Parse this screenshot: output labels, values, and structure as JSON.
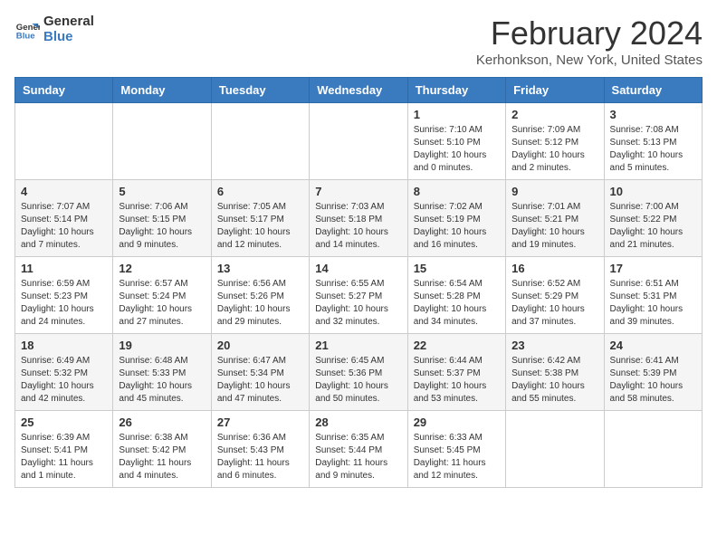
{
  "logo": {
    "line1": "General",
    "line2": "Blue"
  },
  "title": "February 2024",
  "subtitle": "Kerhonkson, New York, United States",
  "days_of_week": [
    "Sunday",
    "Monday",
    "Tuesday",
    "Wednesday",
    "Thursday",
    "Friday",
    "Saturday"
  ],
  "weeks": [
    [
      {
        "day": "",
        "info": ""
      },
      {
        "day": "",
        "info": ""
      },
      {
        "day": "",
        "info": ""
      },
      {
        "day": "",
        "info": ""
      },
      {
        "day": "1",
        "info": "Sunrise: 7:10 AM\nSunset: 5:10 PM\nDaylight: 10 hours\nand 0 minutes."
      },
      {
        "day": "2",
        "info": "Sunrise: 7:09 AM\nSunset: 5:12 PM\nDaylight: 10 hours\nand 2 minutes."
      },
      {
        "day": "3",
        "info": "Sunrise: 7:08 AM\nSunset: 5:13 PM\nDaylight: 10 hours\nand 5 minutes."
      }
    ],
    [
      {
        "day": "4",
        "info": "Sunrise: 7:07 AM\nSunset: 5:14 PM\nDaylight: 10 hours\nand 7 minutes."
      },
      {
        "day": "5",
        "info": "Sunrise: 7:06 AM\nSunset: 5:15 PM\nDaylight: 10 hours\nand 9 minutes."
      },
      {
        "day": "6",
        "info": "Sunrise: 7:05 AM\nSunset: 5:17 PM\nDaylight: 10 hours\nand 12 minutes."
      },
      {
        "day": "7",
        "info": "Sunrise: 7:03 AM\nSunset: 5:18 PM\nDaylight: 10 hours\nand 14 minutes."
      },
      {
        "day": "8",
        "info": "Sunrise: 7:02 AM\nSunset: 5:19 PM\nDaylight: 10 hours\nand 16 minutes."
      },
      {
        "day": "9",
        "info": "Sunrise: 7:01 AM\nSunset: 5:21 PM\nDaylight: 10 hours\nand 19 minutes."
      },
      {
        "day": "10",
        "info": "Sunrise: 7:00 AM\nSunset: 5:22 PM\nDaylight: 10 hours\nand 21 minutes."
      }
    ],
    [
      {
        "day": "11",
        "info": "Sunrise: 6:59 AM\nSunset: 5:23 PM\nDaylight: 10 hours\nand 24 minutes."
      },
      {
        "day": "12",
        "info": "Sunrise: 6:57 AM\nSunset: 5:24 PM\nDaylight: 10 hours\nand 27 minutes."
      },
      {
        "day": "13",
        "info": "Sunrise: 6:56 AM\nSunset: 5:26 PM\nDaylight: 10 hours\nand 29 minutes."
      },
      {
        "day": "14",
        "info": "Sunrise: 6:55 AM\nSunset: 5:27 PM\nDaylight: 10 hours\nand 32 minutes."
      },
      {
        "day": "15",
        "info": "Sunrise: 6:54 AM\nSunset: 5:28 PM\nDaylight: 10 hours\nand 34 minutes."
      },
      {
        "day": "16",
        "info": "Sunrise: 6:52 AM\nSunset: 5:29 PM\nDaylight: 10 hours\nand 37 minutes."
      },
      {
        "day": "17",
        "info": "Sunrise: 6:51 AM\nSunset: 5:31 PM\nDaylight: 10 hours\nand 39 minutes."
      }
    ],
    [
      {
        "day": "18",
        "info": "Sunrise: 6:49 AM\nSunset: 5:32 PM\nDaylight: 10 hours\nand 42 minutes."
      },
      {
        "day": "19",
        "info": "Sunrise: 6:48 AM\nSunset: 5:33 PM\nDaylight: 10 hours\nand 45 minutes."
      },
      {
        "day": "20",
        "info": "Sunrise: 6:47 AM\nSunset: 5:34 PM\nDaylight: 10 hours\nand 47 minutes."
      },
      {
        "day": "21",
        "info": "Sunrise: 6:45 AM\nSunset: 5:36 PM\nDaylight: 10 hours\nand 50 minutes."
      },
      {
        "day": "22",
        "info": "Sunrise: 6:44 AM\nSunset: 5:37 PM\nDaylight: 10 hours\nand 53 minutes."
      },
      {
        "day": "23",
        "info": "Sunrise: 6:42 AM\nSunset: 5:38 PM\nDaylight: 10 hours\nand 55 minutes."
      },
      {
        "day": "24",
        "info": "Sunrise: 6:41 AM\nSunset: 5:39 PM\nDaylight: 10 hours\nand 58 minutes."
      }
    ],
    [
      {
        "day": "25",
        "info": "Sunrise: 6:39 AM\nSunset: 5:41 PM\nDaylight: 11 hours\nand 1 minute."
      },
      {
        "day": "26",
        "info": "Sunrise: 6:38 AM\nSunset: 5:42 PM\nDaylight: 11 hours\nand 4 minutes."
      },
      {
        "day": "27",
        "info": "Sunrise: 6:36 AM\nSunset: 5:43 PM\nDaylight: 11 hours\nand 6 minutes."
      },
      {
        "day": "28",
        "info": "Sunrise: 6:35 AM\nSunset: 5:44 PM\nDaylight: 11 hours\nand 9 minutes."
      },
      {
        "day": "29",
        "info": "Sunrise: 6:33 AM\nSunset: 5:45 PM\nDaylight: 11 hours\nand 12 minutes."
      },
      {
        "day": "",
        "info": ""
      },
      {
        "day": "",
        "info": ""
      }
    ]
  ]
}
